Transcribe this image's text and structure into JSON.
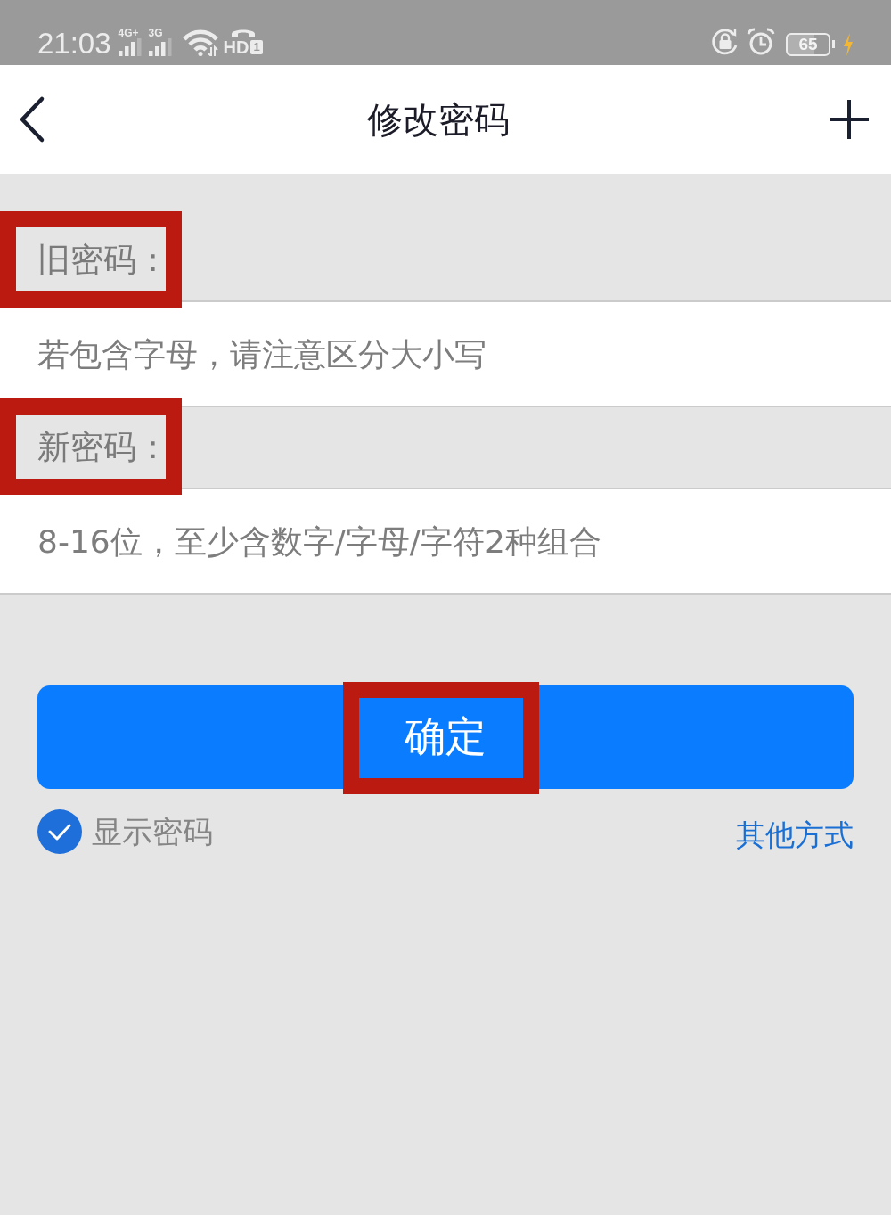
{
  "status_bar": {
    "time": "21:03",
    "networks": [
      {
        "label": "4G+"
      },
      {
        "label": "3G"
      }
    ],
    "volte": {
      "label": "HD",
      "sim": "1"
    },
    "battery": {
      "text": "65",
      "charging": true
    }
  },
  "nav": {
    "title": "修改密码"
  },
  "fields": [
    {
      "label": "旧密码：",
      "placeholder": "若包含字母，请注意区分大小写",
      "highlighted": true
    },
    {
      "label": "新密码：",
      "placeholder": "8-16位，至少含数字/字母/字符2种组合",
      "highlighted": true
    }
  ],
  "confirm_button": {
    "label": "确定",
    "highlighted": true
  },
  "show_password": {
    "label": "显示密码",
    "checked": true
  },
  "other_methods": {
    "label": "其他方式"
  }
}
